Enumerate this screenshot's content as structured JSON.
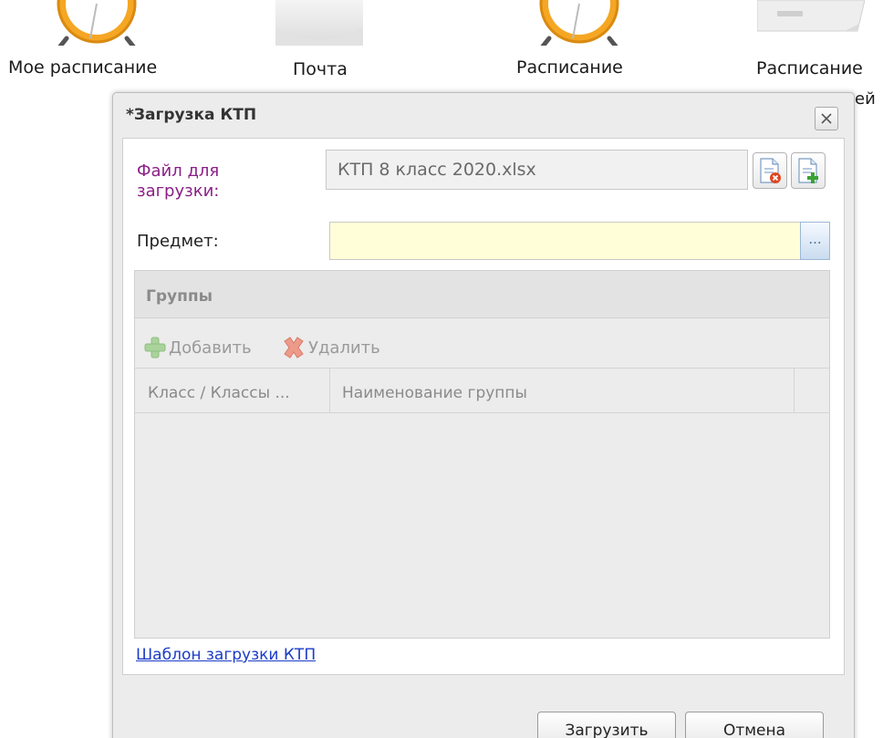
{
  "desktop": {
    "icons": [
      {
        "label": "Мое расписание",
        "art": "alarm-clock-icon"
      },
      {
        "label": "Почта",
        "art": "mail-icon"
      },
      {
        "label": "Расписание",
        "art": "alarm-clock-icon"
      },
      {
        "label": "Расписание",
        "label_overflow": "ей",
        "art": "document-icon"
      }
    ]
  },
  "dialog": {
    "title": "*Загрузка КТП",
    "close_icon": "close-icon",
    "file_label": "Файл для загрузки:",
    "file_value": "КТП 8 класс 2020.xlsx",
    "clear_file_icon": "file-delete-icon",
    "add_file_icon": "file-add-icon",
    "subject_label": "Предмет:",
    "subject_value": "",
    "browse_label": "...",
    "groups": {
      "title": "Группы",
      "add_label": "Добавить",
      "delete_label": "Удалить",
      "columns": [
        "Класс / Классы ...",
        "Наименование группы"
      ],
      "rows": []
    },
    "template_link": "Шаблон загрузки КТП",
    "upload_label": "Загрузить",
    "cancel_label": "Отмена"
  },
  "colors": {
    "required_label": "#8c1e87",
    "subject_bg": "#fffed9",
    "link": "#1a3cc8",
    "panel_bg": "#ececec"
  }
}
